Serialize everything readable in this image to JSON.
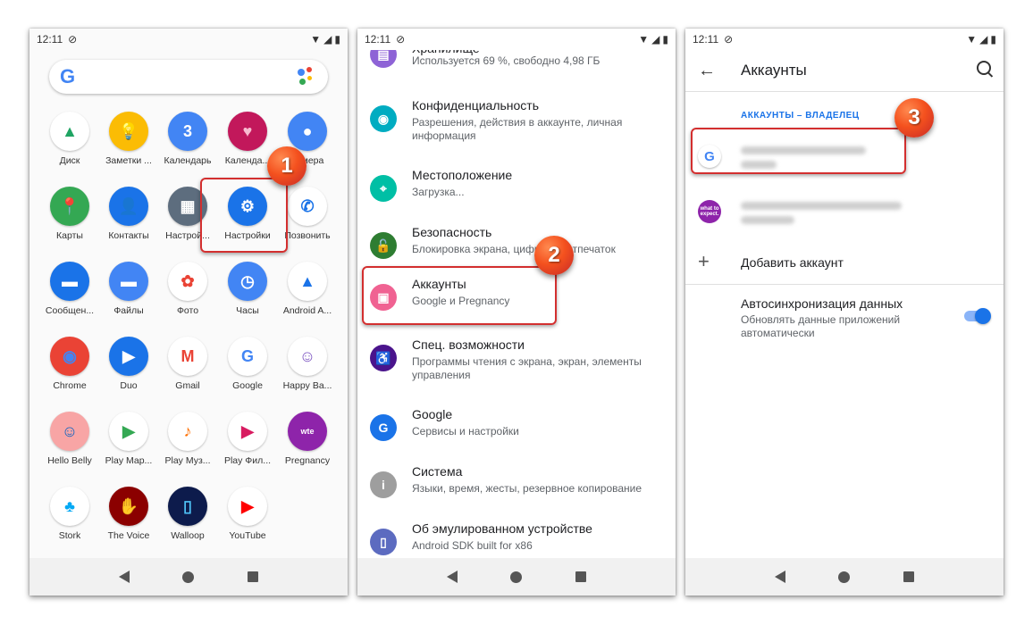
{
  "status": {
    "time": "12:11"
  },
  "home": {
    "apps": [
      {
        "label": "Диск",
        "icon": "drive-icon",
        "bg": "#ffffff",
        "glyph": "▲",
        "color": "#1fa463"
      },
      {
        "label": "Заметки ...",
        "icon": "keep-icon",
        "bg": "#fbbc04",
        "glyph": "💡",
        "color": "#fff"
      },
      {
        "label": "Календарь",
        "icon": "calendar-icon",
        "bg": "#4285f4",
        "glyph": "3",
        "color": "#fff"
      },
      {
        "label": "Календа...",
        "icon": "heart-calendar-icon",
        "bg": "#c2185b",
        "glyph": "♥",
        "color": "#f8bbd0"
      },
      {
        "label": "Камера",
        "icon": "camera-icon",
        "bg": "#4285f4",
        "glyph": "●",
        "color": "#fff"
      },
      {
        "label": "Карты",
        "icon": "maps-icon",
        "bg": "#34a853",
        "glyph": "📍",
        "color": "#ea4335"
      },
      {
        "label": "Контакты",
        "icon": "contacts-icon",
        "bg": "#1a73e8",
        "glyph": "👤",
        "color": "#fff"
      },
      {
        "label": "Настрой...",
        "icon": "wallpaper-icon",
        "bg": "#5d6d7e",
        "glyph": "▦",
        "color": "#fff"
      },
      {
        "label": "Настройки",
        "icon": "settings-gear-icon",
        "bg": "#1a73e8",
        "glyph": "⚙",
        "color": "#fff"
      },
      {
        "label": "Позвонить",
        "icon": "phone-icon",
        "bg": "#ffffff",
        "glyph": "✆",
        "color": "#1a73e8"
      },
      {
        "label": "Сообщен...",
        "icon": "messages-icon",
        "bg": "#1a73e8",
        "glyph": "▬",
        "color": "#fff"
      },
      {
        "label": "Файлы",
        "icon": "files-icon",
        "bg": "#4285f4",
        "glyph": "▬",
        "color": "#fff"
      },
      {
        "label": "Фото",
        "icon": "photos-icon",
        "bg": "#ffffff",
        "glyph": "✿",
        "color": "#ea4335"
      },
      {
        "label": "Часы",
        "icon": "clock-icon",
        "bg": "#4285f4",
        "glyph": "◷",
        "color": "#fff"
      },
      {
        "label": "Android A...",
        "icon": "android-auto-icon",
        "bg": "#ffffff",
        "glyph": "▲",
        "color": "#1a73e8"
      },
      {
        "label": "Chrome",
        "icon": "chrome-icon",
        "bg": "#ea4335",
        "glyph": "◉",
        "color": "#4285f4"
      },
      {
        "label": "Duo",
        "icon": "duo-icon",
        "bg": "#1a73e8",
        "glyph": "▶",
        "color": "#fff"
      },
      {
        "label": "Gmail",
        "icon": "gmail-icon",
        "bg": "#ffffff",
        "glyph": "M",
        "color": "#ea4335"
      },
      {
        "label": "Google",
        "icon": "google-icon",
        "bg": "#ffffff",
        "glyph": "G",
        "color": "#4285f4"
      },
      {
        "label": "Happy Ba...",
        "icon": "happy-baby-icon",
        "bg": "#ffffff",
        "glyph": "☺",
        "color": "#7e57c2"
      },
      {
        "label": "Hello Belly",
        "icon": "hello-belly-icon",
        "bg": "#f8a5a5",
        "glyph": "☺",
        "color": "#1565c0"
      },
      {
        "label": "Play Мар...",
        "icon": "play-market-icon",
        "bg": "#ffffff",
        "glyph": "▶",
        "color": "#34a853"
      },
      {
        "label": "Play Муз...",
        "icon": "play-music-icon",
        "bg": "#ffffff",
        "glyph": "♪",
        "color": "#ff6f00"
      },
      {
        "label": "Play Фил...",
        "icon": "play-movies-icon",
        "bg": "#ffffff",
        "glyph": "▶",
        "color": "#d81b60"
      },
      {
        "label": "Pregnancy",
        "icon": "what-to-expect-icon",
        "bg": "#8e24aa",
        "glyph": "wte",
        "color": "#fff"
      },
      {
        "label": "Stork",
        "icon": "stork-icon",
        "bg": "#ffffff",
        "glyph": "♣",
        "color": "#03a9f4"
      },
      {
        "label": "The Voice",
        "icon": "the-voice-icon",
        "bg": "#8b0000",
        "glyph": "✋",
        "color": "#fff"
      },
      {
        "label": "Walloop",
        "icon": "walloop-icon",
        "bg": "#0d1b4c",
        "glyph": "▯",
        "color": "#4fc3f7"
      },
      {
        "label": "YouTube",
        "icon": "youtube-icon",
        "bg": "#ffffff",
        "glyph": "▶",
        "color": "#ff0000"
      }
    ]
  },
  "settings": {
    "items": [
      {
        "title": "Хранилище",
        "sub": "Используется 69 %, свободно 4,98 ГБ",
        "icon": "storage-icon",
        "bg": "#8e63d6"
      },
      {
        "title": "Конфиденциальность",
        "sub": "Разрешения, действия в аккаунте, личная информация",
        "icon": "privacy-eye-icon",
        "bg": "#00acc1"
      },
      {
        "title": "Местоположение",
        "sub": "Загрузка...",
        "icon": "location-pin-icon",
        "bg": "#00bfa5"
      },
      {
        "title": "Безопасность",
        "sub": "Блокировка экрана, цифровой отпечаток",
        "icon": "lock-icon",
        "bg": "#2e7d32"
      },
      {
        "title": "Аккаунты",
        "sub": "Google и Pregnancy",
        "icon": "accounts-icon",
        "bg": "#f06292"
      },
      {
        "title": "Спец. возможности",
        "sub": "Программы чтения с экрана, экран, элементы управления",
        "icon": "accessibility-icon",
        "bg": "#4a148c"
      },
      {
        "title": "Google",
        "sub": "Сервисы и настройки",
        "icon": "google-g-icon",
        "bg": "#1a73e8"
      },
      {
        "title": "Система",
        "sub": "Языки, время, жесты, резервное копирование",
        "icon": "info-icon",
        "bg": "#9e9e9e"
      },
      {
        "title": "Об эмулированном устройстве",
        "sub": "Android SDK built for x86",
        "icon": "device-icon",
        "bg": "#5c6bc0"
      }
    ]
  },
  "accounts": {
    "title": "Аккаунты",
    "section": "АККАУНТЫ – ВЛАДЕЛЕЦ",
    "add_label": "Добавить аккаунт",
    "sync_title": "Автосинхронизация данных",
    "sync_sub": "Обновлять данные приложений автоматически",
    "wte_logo": "what to expect."
  },
  "badges": {
    "one": "1",
    "two": "2",
    "three": "3"
  },
  "colors": {
    "accent": "#1a73e8",
    "callout": "#d32f2f"
  }
}
